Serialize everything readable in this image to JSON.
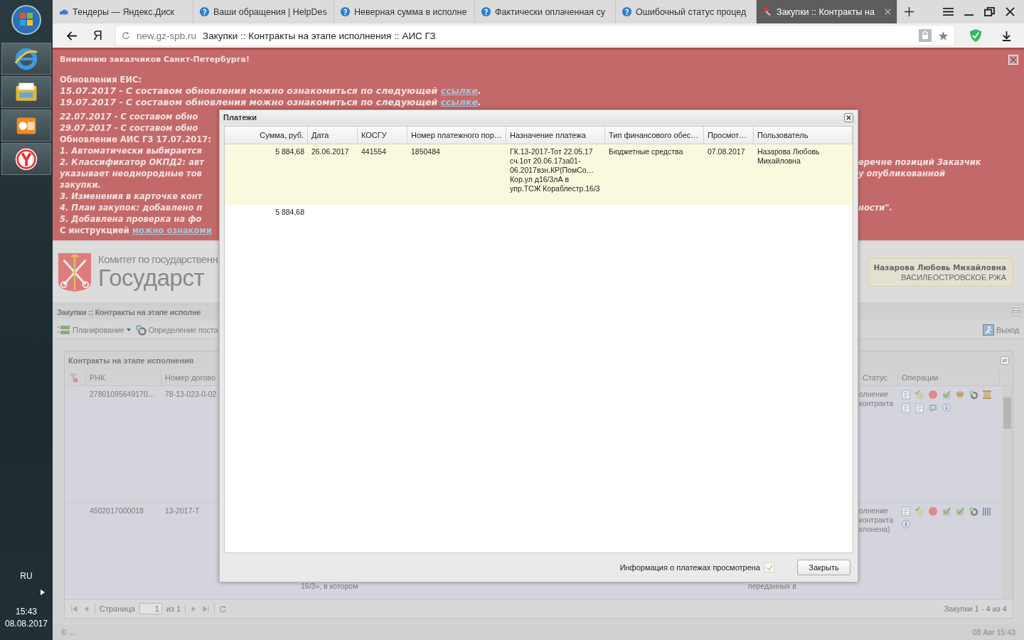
{
  "taskbar": {
    "language": "RU",
    "time": "15:43",
    "date": "08.08.2017"
  },
  "browser": {
    "tabs": [
      {
        "title": "Тендеры — Яндекс.Диск",
        "kind": "disk",
        "selected": false
      },
      {
        "title": "Ваши обращения | HelpDes",
        "kind": "help",
        "selected": false
      },
      {
        "title": "Неверная сумма в исполне",
        "kind": "help",
        "selected": false
      },
      {
        "title": "Фактически оплаченная су",
        "kind": "help",
        "selected": false
      },
      {
        "title": "Ошибочный статус процед",
        "kind": "help",
        "selected": false
      },
      {
        "title": "Закупки :: Контракты на",
        "kind": "tool",
        "selected": true
      }
    ],
    "logo": "Я",
    "domain": "new.gz-spb.ru",
    "page_title": "Закупки :: Контракты на этапе исполнения :: АИС ГЗ"
  },
  "banner": {
    "heading": "Вниманию заказчиков Санкт-Петербурга!",
    "lines": [
      {
        "text": "Обновления ЕИС:",
        "kind": "plain"
      },
      {
        "text": "15.07.2017 - С составом обновления можно ознакомиться по следующей",
        "kind": "italic",
        "link": "ссылке",
        "tail": "."
      },
      {
        "text": "19.07.2017 - С составом обновления можно ознакомиться по следующей",
        "kind": "italic",
        "link": "ссылке",
        "tail": "."
      }
    ],
    "cut_lines": [
      {
        "text": "22.07.2017 - С составом обно",
        "kind": "italic"
      },
      {
        "text": "29.07.2017 - С составом обно",
        "kind": "italic"
      },
      {
        "text": "Обновление АИС ГЗ 17.07.2017:",
        "kind": "plain"
      },
      {
        "text": "1. Автоматически выбирается",
        "kind": "italic"
      },
      {
        "text": "2. Классификатор ОКПД2: авт",
        "kind": "italic",
        "right": "еречне позиций Заказчик"
      },
      {
        "text": "указывает неоднородные тов",
        "kind": "italic",
        "right": "у опубликованной"
      },
      {
        "text": "закупки.",
        "kind": "italic"
      },
      {
        "text": "3. Изменения в карточке конт",
        "kind": "italic"
      },
      {
        "text": "4. План закупок: добавлено п",
        "kind": "italic",
        "right": "ности\"."
      },
      {
        "text": "5. Добавлена проверка на фо",
        "kind": "italic"
      },
      {
        "text": "С инструкцией",
        "kind": "plain",
        "link": "можно ознакоми"
      }
    ]
  },
  "header": {
    "org_line": "Комитет по государственн",
    "system": "Государст",
    "user": {
      "name": "Назарова Любовь Михайловна",
      "org": "ВАСИЛЕОСТРОВСКОЕ РЖА"
    }
  },
  "panel": {
    "title": "Закупки :: Контракты на этапе исполне",
    "toolbar": [
      "Планирование",
      "Определение поста"
    ],
    "exit": "Выход"
  },
  "grid": {
    "title": "Контракты на этапе исполнения",
    "columns": {
      "rnk": "РНК",
      "number": "Номер догово",
      "status": "Статус",
      "operations": "Операции"
    },
    "rows": [
      {
        "rnk": "27801095649170…",
        "number": "78-13-023-0-02",
        "status": "олнение контракта"
      },
      {
        "rnk": "4502017000018",
        "number": "13-2017-Т",
        "subject": "16/3», в котором",
        "column_5": "переданных в",
        "status": "олнение контракта клонена)"
      }
    ],
    "pager": {
      "page_label": "Страница",
      "page": "1",
      "of": "из 1",
      "summary": "Закупки 1 - 4 из 4"
    }
  },
  "footer": {
    "copyright": "© ...",
    "datetime": "08 Авг 15:43"
  },
  "dialog": {
    "title": "Платежи",
    "columns": [
      "Сумма, руб.",
      "Дата",
      "КОСГУ",
      "Номер платежного пор…",
      "Назначение платежа",
      "Тип финансового обес…",
      "Просмот…",
      "Пользователь"
    ],
    "rows": [
      {
        "cells": [
          "5 884,68",
          "26.06.2017",
          "441554",
          "1850484",
          "ГК.13-2017-Тот 22.05.17 сч.1от 20.06.17за01-06.2017взн.КР(ПомСо… Кор.ул д16/3лА в упр.ТСЖ Кораблестр.16/3",
          "Бюджетные средства",
          "07.08.2017",
          "Назарова Любовь Михайловна"
        ],
        "selected": true
      }
    ],
    "total": "5 884,68",
    "viewed": {
      "label": "Информация о платежах просмотрена",
      "checked": true
    },
    "close_button": "Закрыть"
  }
}
